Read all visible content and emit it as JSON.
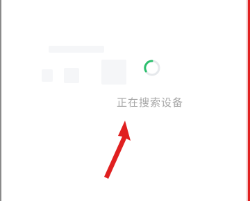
{
  "loading": {
    "status_text": "正在搜索设备",
    "spinner_icon": "loading-spinner-icon",
    "accent_color": "#2dbf6e"
  },
  "annotation": {
    "icon": "red-arrow-icon",
    "color": "#e02020"
  }
}
